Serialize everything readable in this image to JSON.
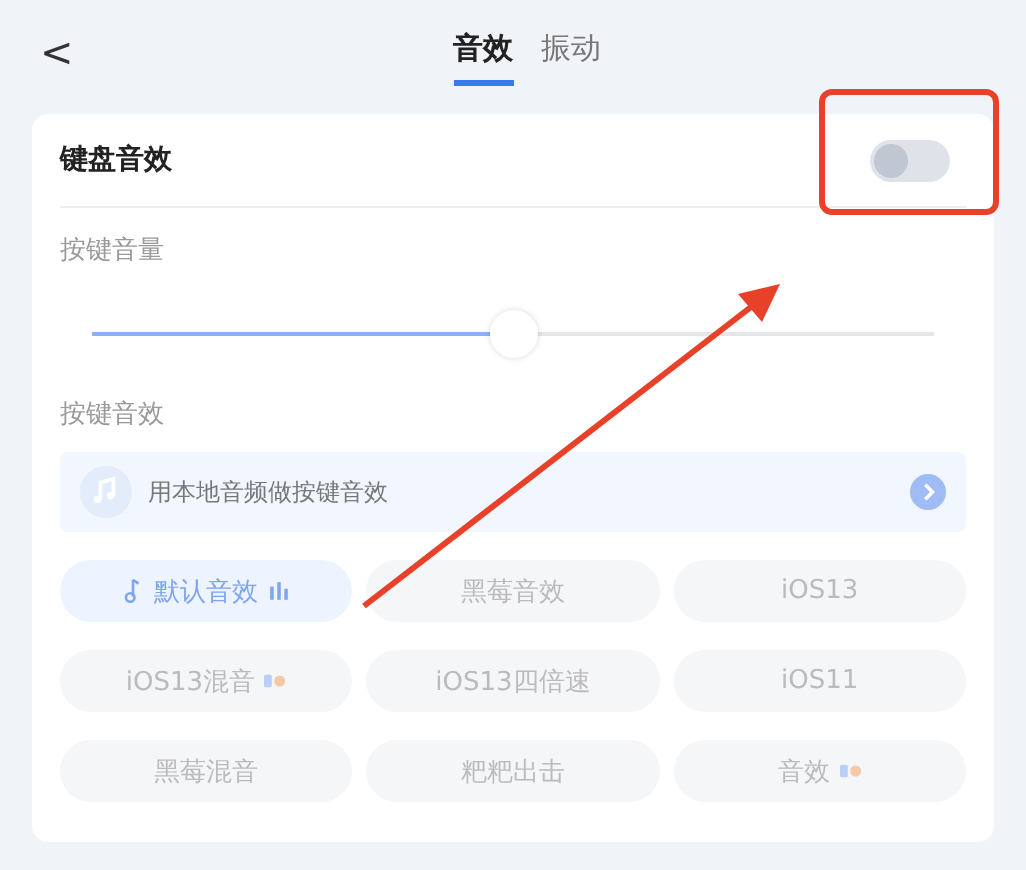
{
  "header": {
    "back": "<"
  },
  "tabs": [
    {
      "label": "音效",
      "selected": true
    },
    {
      "label": "振动",
      "selected": false
    }
  ],
  "keyboard_sound": {
    "label": "键盘音效",
    "on": false
  },
  "volume": {
    "label": "按键音量",
    "level": 0.5
  },
  "sounds": {
    "label": "按键音效",
    "banner": "用本地音频做按键音效",
    "options": [
      {
        "label": "默认音效",
        "selected": true
      },
      {
        "label": "黑莓音效",
        "selected": false
      },
      {
        "label": "iOS13",
        "selected": false
      },
      {
        "label": "iOS13混音",
        "selected": false,
        "badge": true
      },
      {
        "label": "iOS13四倍速",
        "selected": false
      },
      {
        "label": "iOS11",
        "selected": false
      },
      {
        "label": "黑莓混音",
        "selected": false
      },
      {
        "label": "粑粑出击",
        "selected": false
      },
      {
        "label": "音效",
        "selected": false,
        "badge": true
      }
    ]
  }
}
